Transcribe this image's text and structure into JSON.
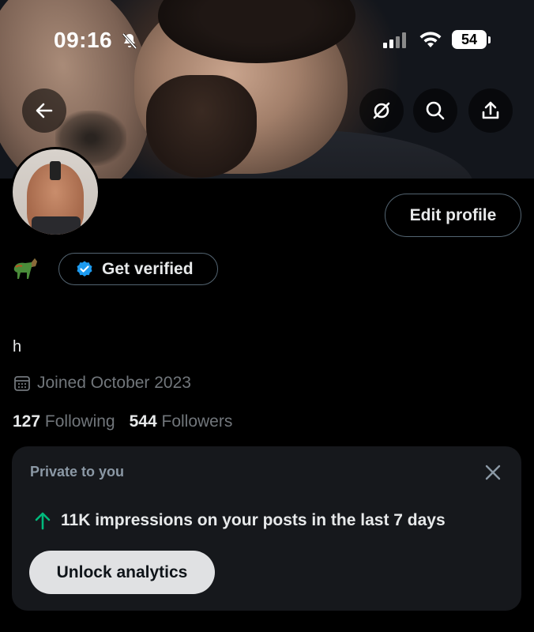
{
  "status_bar": {
    "time": "09:16",
    "battery": "54"
  },
  "profile": {
    "edit_label": "Edit profile",
    "verify_label": "Get verified",
    "bio": "h",
    "joined": "Joined October 2023",
    "following_count": "127",
    "following_label": "Following",
    "followers_count": "544",
    "followers_label": "Followers"
  },
  "analytics_card": {
    "label": "Private to you",
    "impressions_text": "11K impressions on your posts in the last 7 days",
    "unlock_label": "Unlock analytics"
  },
  "colors": {
    "verified_blue": "#1d9bf0",
    "trend_green": "#00ba7c",
    "muted": "#71767b"
  },
  "icons": [
    "bell-slash-icon",
    "signal-icon",
    "wifi-icon",
    "battery-icon",
    "back-arrow-icon",
    "grok-icon",
    "search-icon",
    "share-icon",
    "verified-badge-icon",
    "calendar-icon",
    "close-icon",
    "arrow-up-icon",
    "horse-emoji-icon"
  ]
}
